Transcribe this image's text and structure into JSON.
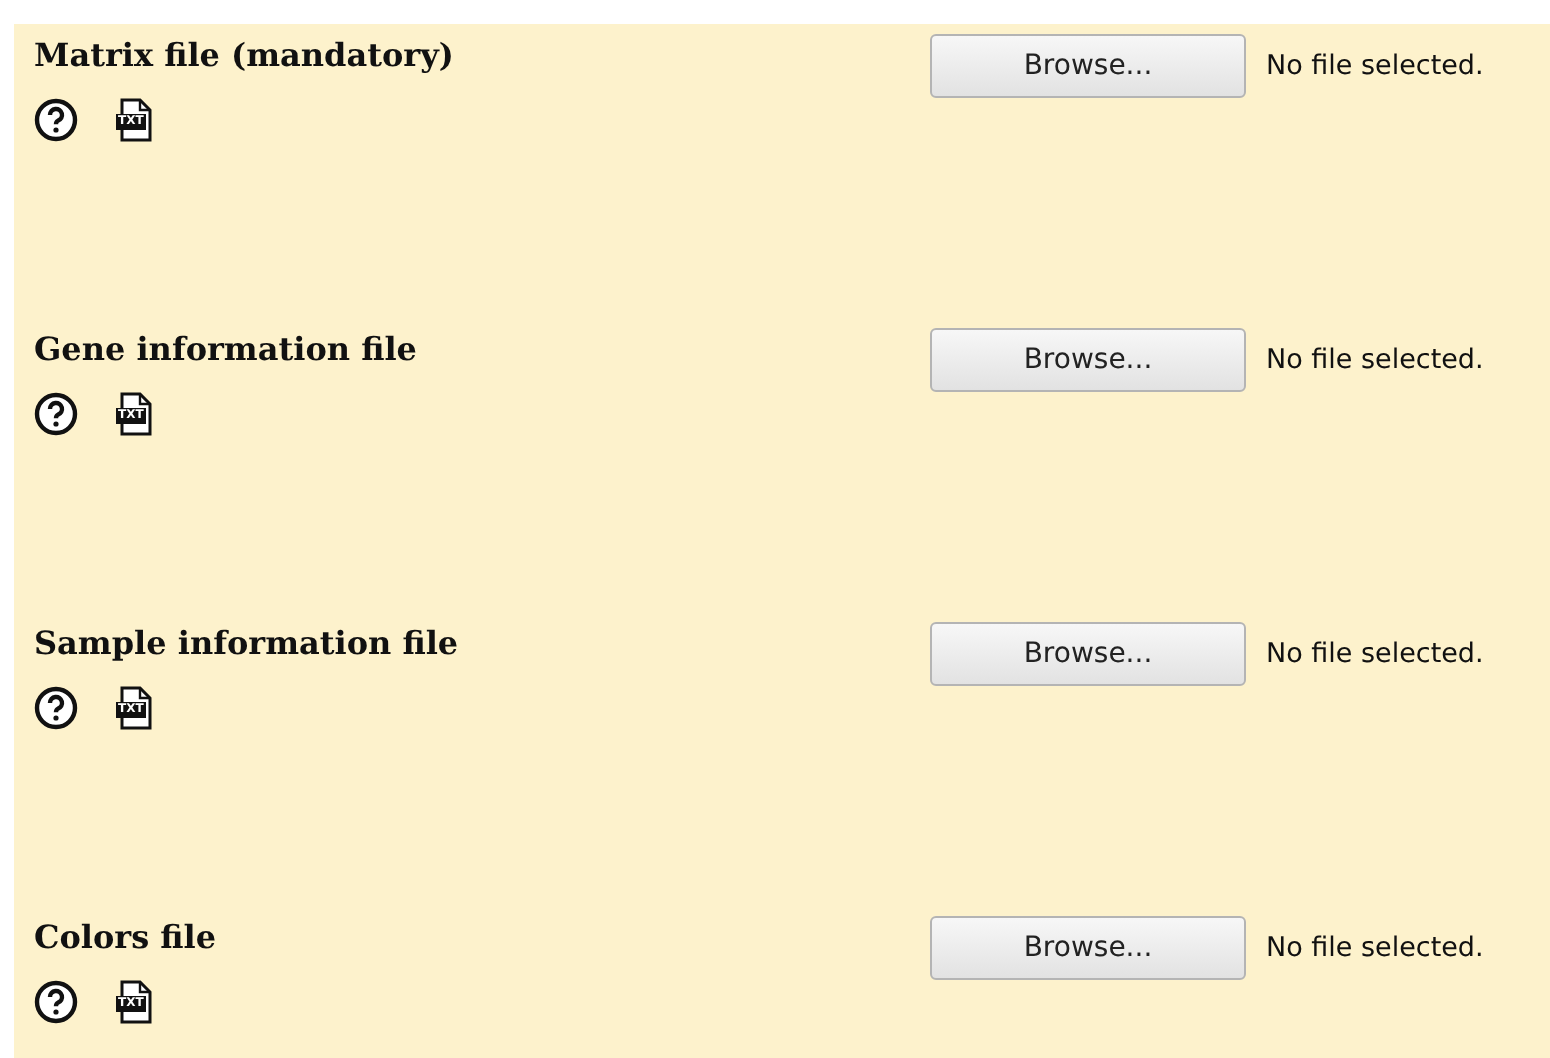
{
  "fields": [
    {
      "label": "Matrix file (mandatory)",
      "button": "Browse...",
      "status": "No file selected.",
      "file_type": "TXT"
    },
    {
      "label": "Gene information file",
      "button": "Browse...",
      "status": "No file selected.",
      "file_type": "TXT"
    },
    {
      "label": "Sample information file",
      "button": "Browse...",
      "status": "No file selected.",
      "file_type": "TXT"
    },
    {
      "label": "Colors file",
      "button": "Browse...",
      "status": "No file selected.",
      "file_type": "TXT"
    }
  ]
}
